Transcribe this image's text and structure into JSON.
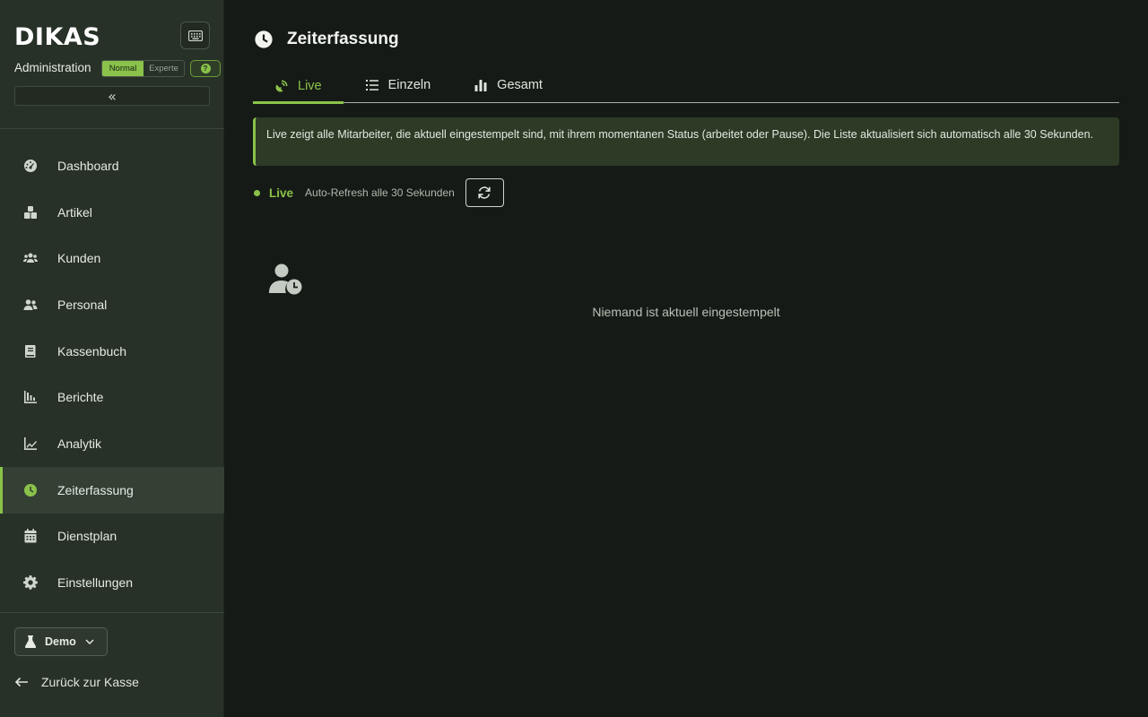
{
  "sidebar": {
    "logo": "DIKAS",
    "admin_label": "Administration",
    "mode_normal": "Normal",
    "mode_expert": "Experte",
    "help": "?",
    "collapse": "«",
    "items": [
      {
        "label": "Dashboard",
        "icon": "dashboard-icon"
      },
      {
        "label": "Artikel",
        "icon": "boxes-icon"
      },
      {
        "label": "Kunden",
        "icon": "users-icon"
      },
      {
        "label": "Personal",
        "icon": "user-group-icon"
      },
      {
        "label": "Kassenbuch",
        "icon": "book-icon"
      },
      {
        "label": "Berichte",
        "icon": "bar-chart-icon"
      },
      {
        "label": "Analytik",
        "icon": "line-chart-icon"
      },
      {
        "label": "Zeiterfassung",
        "icon": "clock-icon",
        "active": true
      },
      {
        "label": "Dienstplan",
        "icon": "calendar-icon"
      },
      {
        "label": "Einstellungen",
        "icon": "gear-icon"
      }
    ],
    "demo_label": "Demo",
    "back_label": "Zurück zur Kasse"
  },
  "main": {
    "title": "Zeiterfassung",
    "tabs": [
      {
        "label": "Live",
        "icon": "satellite-dish-icon",
        "active": true
      },
      {
        "label": "Einzeln",
        "icon": "list-icon"
      },
      {
        "label": "Gesamt",
        "icon": "bar-chart-icon"
      }
    ],
    "info_text": "Live zeigt alle Mitarbeiter, die aktuell eingestempelt sind, mit ihrem momentanen Status (arbeitet oder Pause). Die Liste aktualisiert sich automatisch alle 30 Sekunden.",
    "live_label": "Live",
    "refresh_text": "Auto-Refresh alle 30 Sekunden",
    "empty_text": "Niemand ist aktuell eingestempelt"
  },
  "colors": {
    "accent": "#8ac24a",
    "sidebar_bg": "#273127",
    "main_bg": "#161a16"
  }
}
